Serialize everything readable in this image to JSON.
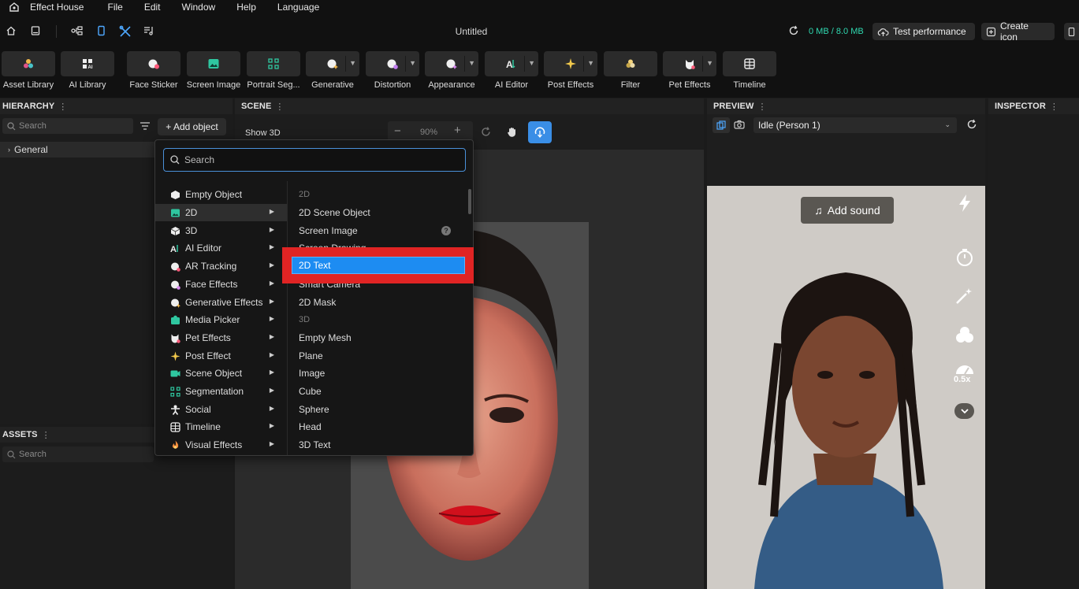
{
  "menubar": {
    "app_name": "Effect House",
    "items": [
      "File",
      "Edit",
      "Window",
      "Help",
      "Language"
    ]
  },
  "toolbar": {
    "doc_title": "Untitled",
    "memory": "0 MB / 8.0 MB",
    "test_performance": "Test performance",
    "create_icon": "Create icon"
  },
  "tools": [
    {
      "label": "Asset Library",
      "icon": "asset-library-icon"
    },
    {
      "label": "AI Library",
      "icon": "ai-library-icon"
    },
    {
      "label": "Face Sticker",
      "icon": "face-sticker-icon"
    },
    {
      "label": "Screen Image",
      "icon": "screen-image-icon"
    },
    {
      "label": "Portrait Seg...",
      "icon": "portrait-seg-icon"
    },
    {
      "label": "Generative",
      "icon": "generative-icon"
    },
    {
      "label": "Distortion",
      "icon": "distortion-icon"
    },
    {
      "label": "Appearance",
      "icon": "appearance-icon"
    },
    {
      "label": "AI Editor",
      "icon": "ai-editor-icon"
    },
    {
      "label": "Post Effects",
      "icon": "post-effects-icon"
    },
    {
      "label": "Filter",
      "icon": "filter-icon"
    },
    {
      "label": "Pet Effects",
      "icon": "pet-effects-icon"
    },
    {
      "label": "Timeline",
      "icon": "timeline-icon"
    }
  ],
  "hierarchy": {
    "title": "HIERARCHY",
    "search_placeholder": "Search",
    "add_object": "+ Add object",
    "root_item": "General"
  },
  "assets": {
    "title": "ASSETS",
    "search_placeholder": "Search"
  },
  "scene": {
    "title": "SCENE",
    "show_3d": "Show 3D",
    "zoom": "90%"
  },
  "preview": {
    "title": "PREVIEW",
    "mode": "Idle (Person 1)",
    "add_sound": "Add sound",
    "speed": "0.5x"
  },
  "inspector": {
    "title": "INSPECTOR"
  },
  "add_menu": {
    "search_placeholder": "Search",
    "categories": [
      {
        "label": "Empty Object",
        "icon": "empty-object-icon",
        "has_submenu": false
      },
      {
        "label": "2D",
        "icon": "2d-icon",
        "has_submenu": true
      },
      {
        "label": "3D",
        "icon": "3d-icon",
        "has_submenu": true
      },
      {
        "label": "AI Editor",
        "icon": "ai-editor-icon",
        "has_submenu": true
      },
      {
        "label": "AR Tracking",
        "icon": "ar-tracking-icon",
        "has_submenu": true
      },
      {
        "label": "Face Effects",
        "icon": "face-effects-icon",
        "has_submenu": true
      },
      {
        "label": "Generative Effects",
        "icon": "generative-effects-icon",
        "has_submenu": true
      },
      {
        "label": "Media Picker",
        "icon": "media-picker-icon",
        "has_submenu": true
      },
      {
        "label": "Pet Effects",
        "icon": "pet-effects-icon",
        "has_submenu": true
      },
      {
        "label": "Post Effect",
        "icon": "post-effect-icon",
        "has_submenu": true
      },
      {
        "label": "Scene Object",
        "icon": "scene-object-icon",
        "has_submenu": true
      },
      {
        "label": "Segmentation",
        "icon": "segmentation-icon",
        "has_submenu": true
      },
      {
        "label": "Social",
        "icon": "social-icon",
        "has_submenu": true
      },
      {
        "label": "Timeline",
        "icon": "timeline-icon",
        "has_submenu": true
      },
      {
        "label": "Visual Effects",
        "icon": "visual-effects-icon",
        "has_submenu": true
      }
    ],
    "active_category": "2D",
    "submenu": [
      {
        "label": "2D",
        "section": true
      },
      {
        "label": "2D Scene Object"
      },
      {
        "label": "Screen Image",
        "help": "?"
      },
      {
        "label": "Screen Drawing"
      },
      {
        "label": "2D Text",
        "selected": true
      },
      {
        "label": "Smart Camera"
      },
      {
        "label": "2D Mask"
      },
      {
        "label": "3D",
        "section": true
      },
      {
        "label": "Empty Mesh"
      },
      {
        "label": "Plane"
      },
      {
        "label": "Image"
      },
      {
        "label": "Cube"
      },
      {
        "label": "Sphere"
      },
      {
        "label": "Head"
      },
      {
        "label": "3D Text"
      }
    ]
  },
  "colors": {
    "accent": "#1d8cf2",
    "highlight": "#e02424",
    "memory": "#2fd8b0"
  }
}
